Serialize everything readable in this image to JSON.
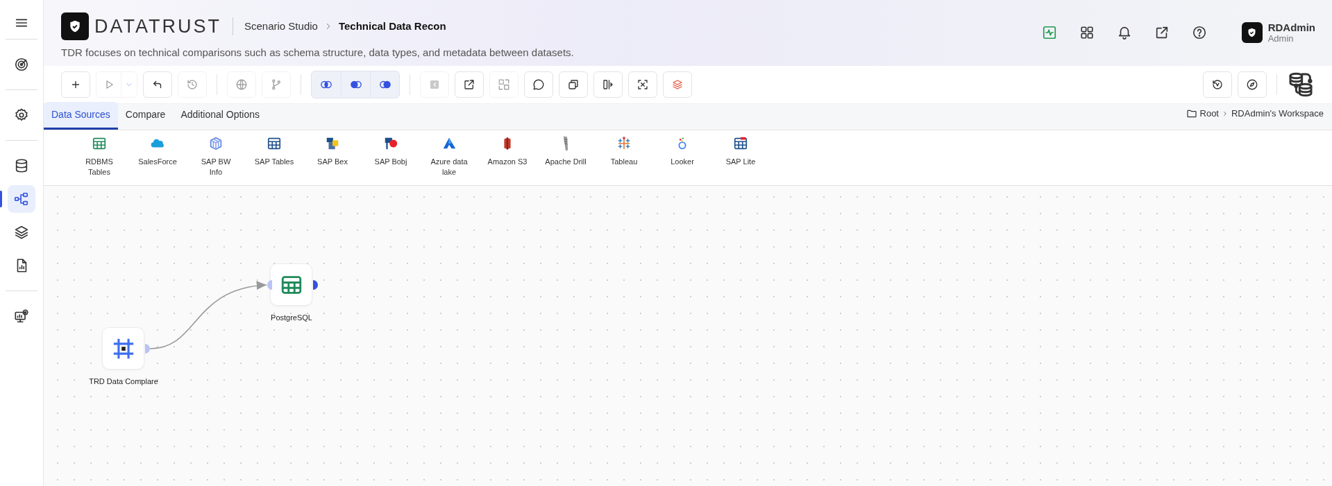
{
  "sidebar": {
    "items": [
      {
        "selected": false
      },
      {
        "selected": false
      },
      {
        "selected": false
      },
      {
        "selected": true
      },
      {
        "selected": false
      },
      {
        "selected": false
      },
      {
        "selected": false
      }
    ]
  },
  "header": {
    "logo": "DATATRUST",
    "breadcrumb": [
      "Scenario Studio",
      "Technical Data Recon"
    ],
    "description": "TDR focuses on technical comparisons such as schema structure, data types, and metadata between datasets.",
    "user": {
      "name": "RDAdmin",
      "role": "Admin"
    }
  },
  "toolbar": {
    "groups": [
      {
        "kind": "plain",
        "buttons": [
          {
            "kind": "icon",
            "disabled": false
          },
          {
            "kind": "split",
            "disabled": true
          },
          {
            "kind": "icon",
            "disabled": false
          },
          {
            "kind": "icon",
            "disabled": true
          }
        ]
      },
      {
        "kind": "plain",
        "buttons": [
          {
            "kind": "icon",
            "disabled": true
          },
          {
            "kind": "icon",
            "disabled": true
          }
        ]
      },
      {
        "kind": "segmented",
        "buttons": [
          {
            "kind": "icon",
            "disabled": false
          },
          {
            "kind": "icon",
            "disabled": false
          },
          {
            "kind": "icon",
            "disabled": false
          }
        ]
      },
      {
        "kind": "plain",
        "buttons": [
          {
            "kind": "icon",
            "disabled": true
          },
          {
            "kind": "icon",
            "disabled": false
          },
          {
            "kind": "icon",
            "disabled": true
          },
          {
            "kind": "icon",
            "disabled": false
          },
          {
            "kind": "icon",
            "disabled": false
          },
          {
            "kind": "icon",
            "disabled": false
          },
          {
            "kind": "icon",
            "disabled": false
          },
          {
            "kind": "icon",
            "disabled": false
          }
        ]
      }
    ]
  },
  "tabs": [
    {
      "label": "Data Sources",
      "selected": true
    },
    {
      "label": "Compare",
      "selected": false
    },
    {
      "label": "Additional Options",
      "selected": false
    }
  ],
  "workspace_path": [
    "Root",
    "RDAdmin's Workspace"
  ],
  "data_sources": [
    {
      "label": "RDBMS Tables"
    },
    {
      "label": "SalesForce"
    },
    {
      "label": "SAP BW Info"
    },
    {
      "label": "SAP Tables"
    },
    {
      "label": "SAP Bex"
    },
    {
      "label": "SAP Bobj"
    },
    {
      "label": "Azure data lake"
    },
    {
      "label": "Amazon S3"
    },
    {
      "label": "Apache Drill"
    },
    {
      "label": "Tableau"
    },
    {
      "label": "Looker"
    },
    {
      "label": "SAP Lite"
    }
  ],
  "canvas": {
    "nodes": [
      {
        "label": "PostgreSQL"
      },
      {
        "label": "TRD Data Complare"
      }
    ]
  }
}
